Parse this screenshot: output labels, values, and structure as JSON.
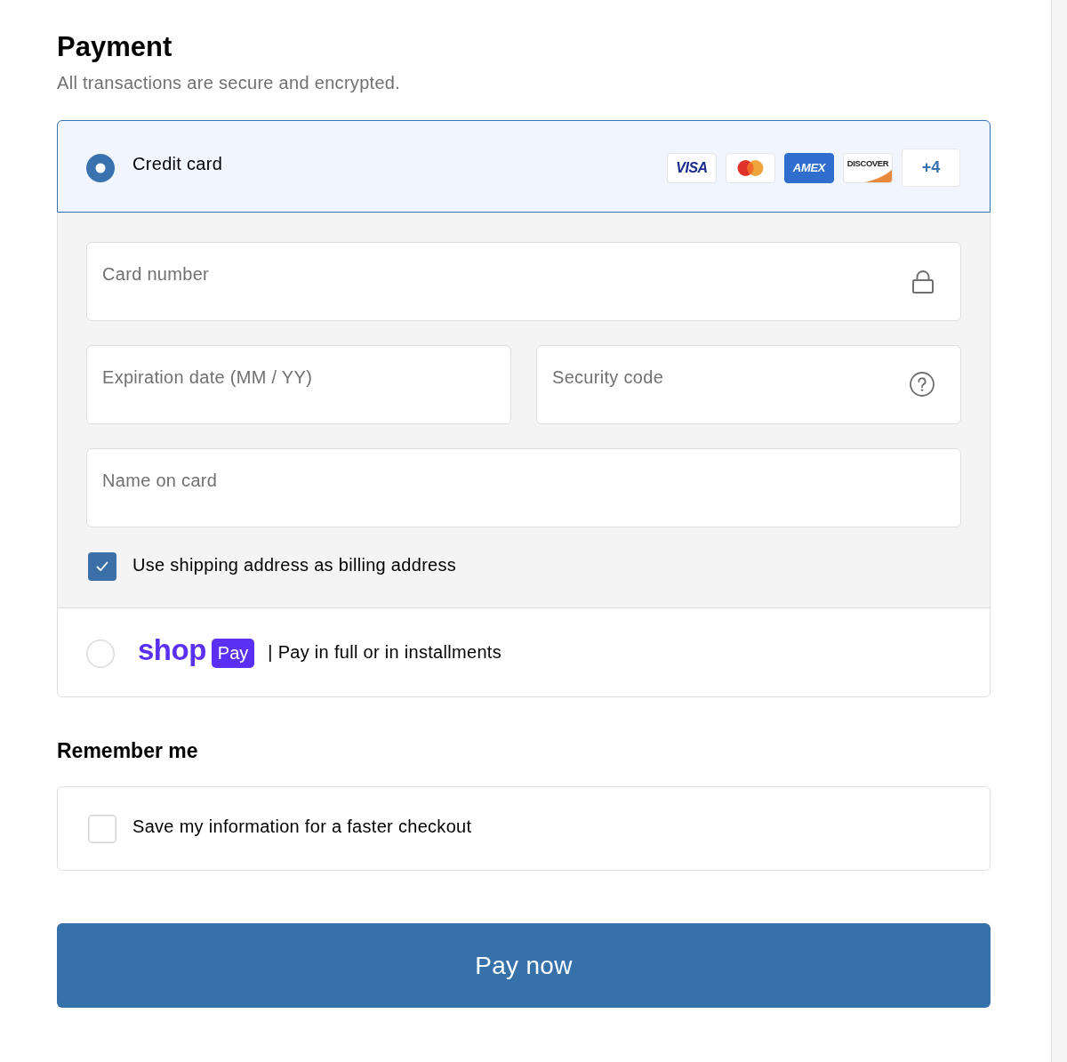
{
  "header": {
    "title": "Payment",
    "subtitle": "All transactions are secure and encrypted."
  },
  "payment_methods": [
    {
      "kind": "card",
      "label": "Credit card",
      "selected": true,
      "brands": [
        {
          "kind": "visa",
          "text": "VISA"
        },
        {
          "kind": "mastercard"
        },
        {
          "kind": "amex",
          "text": "AMEX"
        },
        {
          "kind": "discover",
          "text": "DISCOVER"
        }
      ],
      "more_brands": "+4",
      "fields": [
        {
          "kind": "card_number",
          "placeholder": "Card number"
        },
        {
          "kind": "expiry",
          "placeholder": "Expiration date (MM / YY)"
        },
        {
          "kind": "security_code",
          "placeholder": "Security code"
        },
        {
          "kind": "name",
          "placeholder": "Name on card"
        }
      ],
      "billing_option": {
        "label": "Use shipping address as billing address",
        "checked": true
      }
    },
    {
      "kind": "shop_pay",
      "logo_text": "shop",
      "badge": "Pay",
      "label": "| Pay in full or in installments",
      "selected": false
    }
  ],
  "remember_me": {
    "title": "Remember me",
    "option": {
      "label": "Save my information for a faster checkout",
      "checked": false
    }
  },
  "submit_button": {
    "label": "Pay now"
  }
}
